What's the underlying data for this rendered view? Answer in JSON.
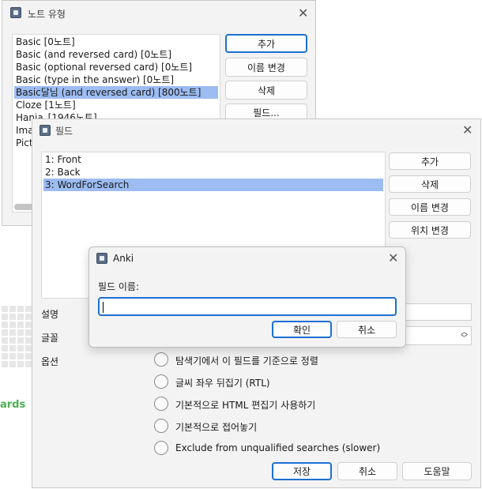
{
  "note_types": {
    "title": "노트 유형",
    "items": [
      "Basic [0노트]",
      "Basic (and reversed card) [0노트]",
      "Basic (optional reversed card) [0노트]",
      "Basic (type in the answer) [0노트]",
      "Basic달님 (and reversed card) [800노트]",
      "Cloze [1노트]",
      "Hanja_[1946노트]",
      "Imag",
      "Pictu"
    ],
    "buttons": {
      "add": "추가",
      "rename": "이름 변경",
      "delete": "삭제",
      "fields": "필드..."
    }
  },
  "fields": {
    "title": "필드",
    "items": [
      "1: Front",
      "2: Back",
      "3: WordForSearch"
    ],
    "buttons": {
      "add": "추가",
      "delete": "삭제",
      "rename": "이름 변경",
      "reposition": "위치 변경"
    },
    "description_label": "설명",
    "font_label": "글꼴",
    "options_label": "옵션",
    "options": [
      "탐색기에서 이 필드를 기준으로 정렬",
      "글씨 좌우 뒤집기 (RTL)",
      "기본적으로 HTML 편집기 사용하기",
      "기본적으로 접어놓기",
      "Exclude from unqualified searches (slower)"
    ],
    "footer": {
      "save": "저장",
      "cancel": "취소",
      "help": "도움말"
    }
  },
  "prompt_dialog": {
    "title": "Anki",
    "label": "필드 이름:",
    "input_value": "",
    "ok": "확인",
    "cancel": "취소"
  },
  "background_fragment": "ards",
  "colors": {
    "selection": "#9cbcf2",
    "accent": "#1d6fd1",
    "fragment_green": "#4caf50"
  }
}
